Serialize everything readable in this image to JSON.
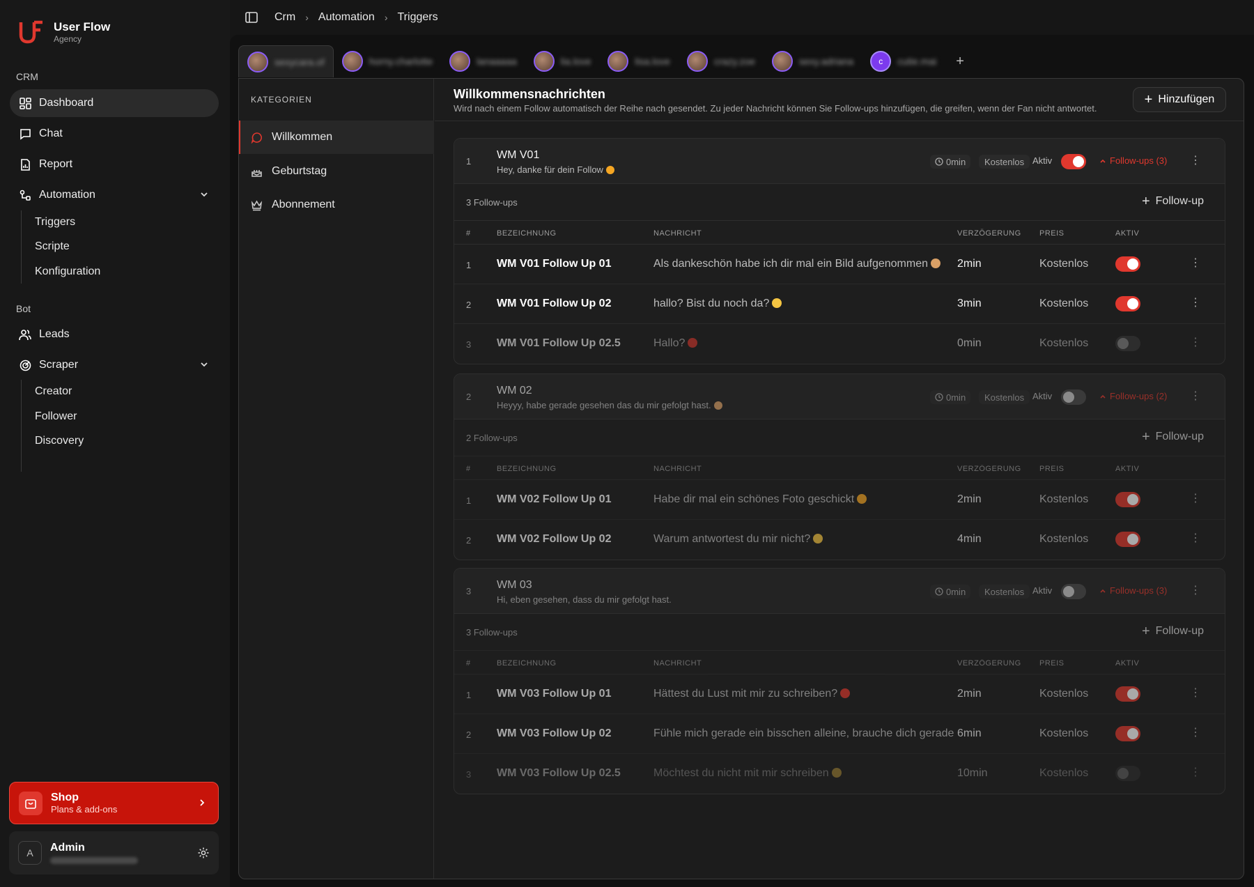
{
  "brand": {
    "name": "User Flow",
    "sub": "Agency"
  },
  "sidebar": {
    "crm_label": "CRM",
    "bot_label": "Bot",
    "items": {
      "dashboard": "Dashboard",
      "chat": "Chat",
      "report": "Report",
      "automation": "Automation",
      "leads": "Leads",
      "scraper": "Scraper"
    },
    "automation_sub": [
      "Triggers",
      "Scripte",
      "Konfiguration"
    ],
    "scraper_sub": [
      "Creator",
      "Follower",
      "Discovery"
    ],
    "shop": {
      "title": "Shop",
      "sub": "Plans & add-ons"
    },
    "admin": {
      "name": "Admin",
      "avatar_letter": "A"
    }
  },
  "breadcrumb": [
    "Crm",
    "Automation",
    "Triggers"
  ],
  "account_tabs": [
    {
      "name": "sexycara.of",
      "active": true
    },
    {
      "name": "horny.charlotte"
    },
    {
      "name": "lanaaaaa"
    },
    {
      "name": "lia.love"
    },
    {
      "name": "lisa.love"
    },
    {
      "name": "crazy.zoe"
    },
    {
      "name": "sexy.adriana"
    },
    {
      "name": "cutie.mai",
      "letter": "c"
    }
  ],
  "categories": {
    "header": "KATEGORIEN",
    "items": [
      "Willkommen",
      "Geburtstag",
      "Abonnement"
    ]
  },
  "content": {
    "title": "Willkommensnachrichten",
    "subtitle": "Wird nach einem Follow automatisch der Reihe nach gesendet. Zu jeder Nachricht können Sie Follow-ups hinzufügen, die greifen, wenn der Fan nicht antwortet.",
    "add_label": "Hinzufügen"
  },
  "labels": {
    "aktiv": "Aktiv",
    "follow_up_add": "Follow-up",
    "col_idx": "#",
    "col_name": "BEZEICHNUNG",
    "col_msg": "NACHRICHT",
    "col_delay": "VERZÖGERUNG",
    "col_price": "PREIS",
    "col_active": "AKTIV"
  },
  "messages": [
    {
      "idx": "1",
      "name": "WM V01",
      "text": "Hey, danke für dein Follow",
      "emoji": "#f5a623",
      "delay": "0min",
      "price": "Kostenlos",
      "active": true,
      "followups_label": "Follow-ups (3)",
      "followups_count": "3 Follow-ups",
      "followups": [
        {
          "idx": "1",
          "name": "WM V01 Follow Up 01",
          "msg": "Als dankeschön habe ich dir mal ein Bild aufgenommen",
          "emoji": "#d9a066",
          "delay": "2min",
          "price": "Kostenlos",
          "active": true
        },
        {
          "idx": "2",
          "name": "WM V01 Follow Up 02",
          "msg": "hallo? Bist du noch da?",
          "emoji": "#f5c542",
          "delay": "3min",
          "price": "Kostenlos",
          "active": true
        },
        {
          "idx": "3",
          "name": "WM V01 Follow Up 02.5",
          "msg": "Hallo?",
          "emoji": "#e0382e",
          "delay": "0min",
          "price": "Kostenlos",
          "active": false
        }
      ]
    },
    {
      "idx": "2",
      "name": "WM 02",
      "text": "Heyyy, habe gerade gesehen das du mir gefolgt hast.",
      "emoji": "#d9a066",
      "delay": "0min",
      "price": "Kostenlos",
      "active": false,
      "followups_label": "Follow-ups (2)",
      "followups_count": "2 Follow-ups",
      "followups": [
        {
          "idx": "1",
          "name": "WM V02 Follow Up 01",
          "msg": "Habe dir mal ein schönes Foto geschickt",
          "emoji": "#f5a623",
          "delay": "2min",
          "price": "Kostenlos",
          "active": true
        },
        {
          "idx": "2",
          "name": "WM V02 Follow Up 02",
          "msg": "Warum antwortest du mir nicht?",
          "emoji": "#f5c542",
          "delay": "4min",
          "price": "Kostenlos",
          "active": true
        }
      ]
    },
    {
      "idx": "3",
      "name": "WM 03",
      "text": "Hi, eben gesehen, dass du mir gefolgt hast.",
      "emoji": "",
      "delay": "0min",
      "price": "Kostenlos",
      "active": false,
      "followups_label": "Follow-ups (3)",
      "followups_count": "3 Follow-ups",
      "followups": [
        {
          "idx": "1",
          "name": "WM V03 Follow Up 01",
          "msg": "Hättest du Lust mit mir zu schreiben?",
          "emoji": "#e0382e",
          "delay": "2min",
          "price": "Kostenlos",
          "active": true
        },
        {
          "idx": "2",
          "name": "WM V03 Follow Up 02",
          "msg": "Fühle mich gerade ein bisschen alleine, brauche dich gerade",
          "emoji": "",
          "delay": "6min",
          "price": "Kostenlos",
          "active": true
        },
        {
          "idx": "3",
          "name": "WM V03 Follow Up 02.5",
          "msg": "Möchtest du nicht mit mir schreiben",
          "emoji": "#f5c542",
          "delay": "10min",
          "price": "Kostenlos",
          "active": false
        }
      ]
    }
  ],
  "colors": {
    "accent": "#e0382e",
    "shop_bg": "#c7140a",
    "background": "#161616",
    "card": "#1c1c1c"
  }
}
